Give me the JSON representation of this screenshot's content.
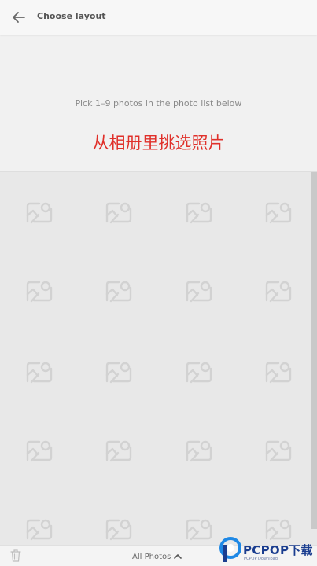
{
  "appbar": {
    "title": "Choose layout",
    "back_icon": "arrow-left-icon"
  },
  "instruction": {
    "text": "Pick 1–9 photos in the photo list below",
    "caption": "从相册里挑选照片"
  },
  "grid": {
    "placeholder_icon": "image-placeholder-icon",
    "rows": 5,
    "columns": 4
  },
  "bottombar": {
    "album_label": "All Photos",
    "trash_icon": "trash-icon",
    "chevron_icon": "chevron-up-icon"
  },
  "watermark": {
    "brand": "PCPOP下载",
    "subtitle": "PCPOP Download"
  },
  "colors": {
    "accent_red": "#e0302a",
    "background": "#e8e8e8",
    "appbar": "#f7f7f7",
    "watermark_blue": "#1a3d8f"
  }
}
